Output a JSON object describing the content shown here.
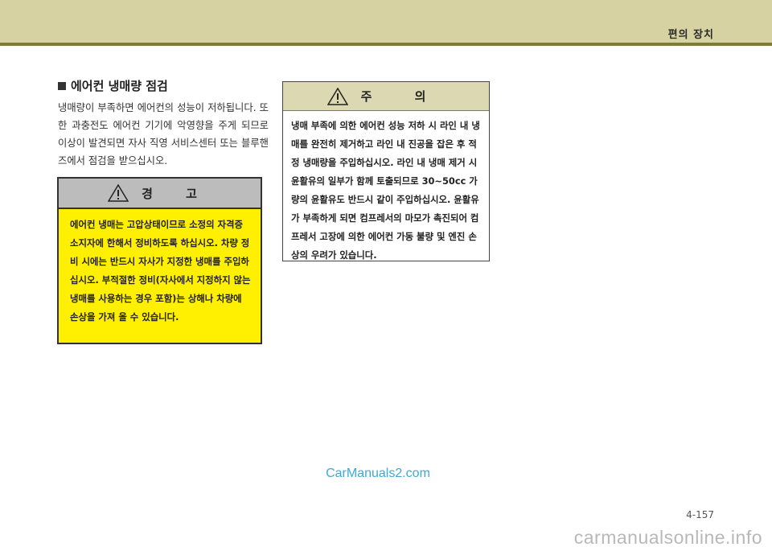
{
  "header": {
    "title": "편의 장치"
  },
  "section": {
    "title": "에어컨 냉매량 점검",
    "intro": "냉매량이 부족하면 에어컨의 성능이 저하됩니다. 또한 과충전도 에어컨 기기에 악영향을 주게 되므로 이상이 발견되면 자사 직영 서비스센터 또는 블루핸즈에서 점검을 받으십시오."
  },
  "warning": {
    "title": "경 고",
    "body": "에어컨 냉매는 고압상태이므로 소정의 자격증 소지자에 한해서 정비하도록 하십시오. 차량 정비 시에는 반드시 자사가 지정한 냉매를 주입하십시오. 부적절한 정비(자사에서 지정하지 않는 냉매를 사용하는 경우 포함)는 상해나 차량에 손상을 가져 올 수 있습니다."
  },
  "caution": {
    "title": "주 의",
    "body": "냉매 부족에 의한 에어컨 성능 저하 시 라인 내 냉매를 완전히 제거하고 라인 내 진공을 잡은 후 적정 냉매량을 주입하십시오. 라인 내 냉매 제거 시 윤활유의 일부가 함께 토출되므로 30~50cc 가량의 윤활유도 반드시 같이 주입하십시오. 윤활유가 부족하게 되면 컴프레서의 마모가 촉진되어 컴프레서 고장에 의한 에어컨 가동 불량 및 엔진 손상의 우려가 있습니다."
  },
  "watermark": "CarManuals2.com",
  "page_number": "4-157",
  "footer_watermark": "carmanualsonline.info"
}
